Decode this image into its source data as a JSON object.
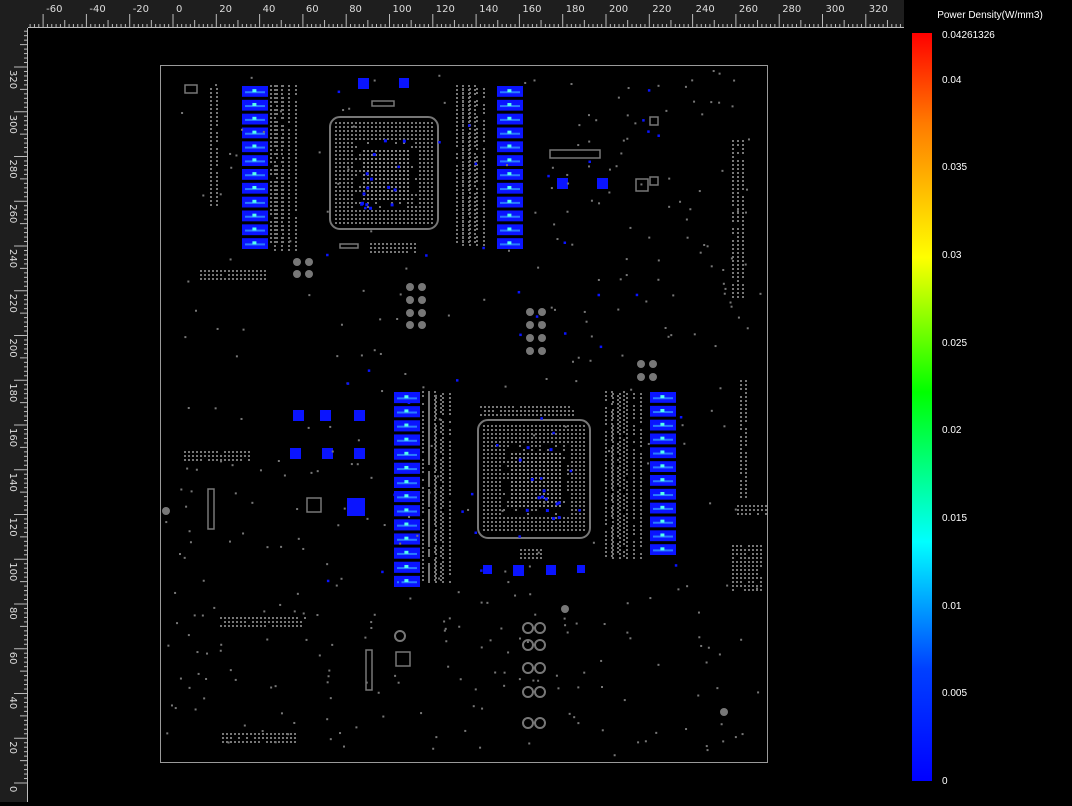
{
  "ruler": {
    "top_ticks": [
      "-60",
      "-40",
      "-20",
      "0",
      "20",
      "40",
      "60",
      "80",
      "100",
      "120",
      "140",
      "160",
      "180",
      "200",
      "220",
      "240",
      "260",
      "280",
      "300",
      "320"
    ],
    "left_ticks": [
      "320",
      "300",
      "280",
      "260",
      "240",
      "220",
      "200",
      "180",
      "160",
      "140",
      "120",
      "100",
      "80",
      "60",
      "40",
      "20",
      "0"
    ]
  },
  "legend": {
    "title": "Power Density(W/mm3)",
    "max_label": "0.04261326",
    "labels": [
      "0.04",
      "0.035",
      "0.03",
      "0.025",
      "0.02",
      "0.015",
      "0.01",
      "0.005",
      "0"
    ],
    "colors": {
      "max": "#ff0000",
      "mid": "#00ff00",
      "min": "#0000ff"
    }
  },
  "board": {
    "outline_color": "#9a9a9a",
    "component_color": "#777777",
    "hot_color": "#0a14ff"
  }
}
